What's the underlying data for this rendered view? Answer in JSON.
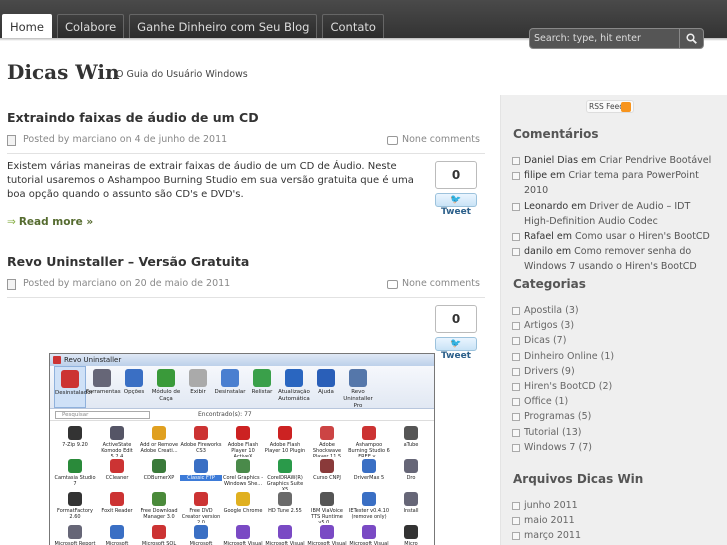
{
  "nav": {
    "tabs": [
      {
        "label": "Home",
        "active": true
      },
      {
        "label": "Colabore",
        "active": false
      },
      {
        "label": "Ganhe Dinheiro com Seu Blog",
        "active": false
      },
      {
        "label": "Contato",
        "active": false
      }
    ]
  },
  "search": {
    "placeholder": "Search: type, hit enter"
  },
  "header": {
    "title": "Dicas Win",
    "description": "O Guia do Usuário Windows"
  },
  "posts": [
    {
      "title": "Extraindo faixas de áudio de um CD",
      "meta": "Posted by marciano on 4 de junho de 2011",
      "comments": "None comments",
      "tweet_count": "0",
      "tweet_label": "Tweet",
      "excerpt": "Existem várias maneiras de extrair faixas de áudio de um CD de Áudio. Neste tutorial usaremos o Ashampoo Burning Studio em sua versão gratuita que é uma boa opção quando o assunto são CD's e DVD's.",
      "read_more": "Read more »"
    },
    {
      "title": "Revo Uninstaller – Versão Gratuita",
      "meta": "Posted by marciano on 20 de maio de 2011",
      "comments": "None comments",
      "tweet_count": "0",
      "tweet_label": "Tweet"
    }
  ],
  "revo": {
    "window_title": "Revo Uninstaller",
    "toolbar": [
      "Desinstalador",
      "Ferramentas",
      "Opções",
      "Módulo de Caça",
      "Exibir",
      "Desinstalar",
      "Relistar",
      "Atualização Automática",
      "Ajuda",
      "Revo Uninstaller Pro"
    ],
    "search_placeholder": "Pesquisar",
    "found": "Encontrado(s): 77",
    "apps": [
      "7-Zip 9.20",
      "ActiveState Komodo Edit 5.2.4",
      "Add or Remove Adobe Creati...",
      "Adobe Fireworks CS3",
      "Adobe Flash Player 10 ActiveX",
      "Adobe Flash Player 10 Plugin",
      "Adobe Shockwave Player 11.5",
      "Ashampoo Burning Studio 6 FREE v...",
      "aTube",
      "Camtasia Studio 7",
      "CCleaner",
      "CDBurnerXP",
      "Classic FTP",
      "Corel Graphics - Windows She...",
      "CorelDRAW(R) Graphics Suite X5",
      "Curso CNPJ",
      "DriverMax 5",
      "Dro",
      "FormatFactory 2.60",
      "Foxit Reader",
      "Free Download Manager 3.0",
      "Free DVD Creator version 2.0",
      "Google Chrome",
      "HD Tune 2.55",
      "IBM ViaVoice TTS Runtime v5.0....",
      "IETester v0.4.10 (remove only)",
      "Install",
      "Microsoft Report",
      "Microsoft",
      "Microsoft SQL",
      "Microsoft",
      "Microsoft Visual",
      "Microsoft Visual",
      "Microsoft Visual",
      "Microsoft Visual",
      "Micro"
    ],
    "selected_app": "Classic FTP"
  },
  "sidebar": {
    "rss_label": "RSS Feed",
    "comments_title": "Comentários",
    "comments": [
      {
        "author": "Daniel Dias",
        "em": "em",
        "post": "Criar Pendrive Bootável"
      },
      {
        "author": "filipe",
        "em": "em",
        "post": "Criar tema para PowerPoint 2010"
      },
      {
        "author": "Leonardo",
        "em": "em",
        "post": "Driver de Audio – IDT High-Definition Audio Codec"
      },
      {
        "author": "Rafael",
        "em": "em",
        "post": "Como usar o Hiren's BootCD"
      },
      {
        "author": "danilo",
        "em": "em",
        "post": "Como remover senha do Windows 7 usando o Hiren's BootCD"
      }
    ],
    "categories_title": "Categorias",
    "categories": [
      "Apostila (3)",
      "Artigos (3)",
      "Dicas (7)",
      "Dinheiro Online (1)",
      "Drivers (9)",
      "Hiren's BootCD (2)",
      "Office (1)",
      "Programas (5)",
      "Tutorial (13)",
      "Windows 7 (7)"
    ],
    "archives_title": "Arquivos Dicas Win",
    "archives": [
      "junho 2011",
      "maio 2011",
      "março 2011"
    ]
  },
  "colors": {
    "topbar": "#333333",
    "sidebar_bg": "#efefef",
    "readmore": "#556b2f",
    "rss": "#f7941d"
  }
}
